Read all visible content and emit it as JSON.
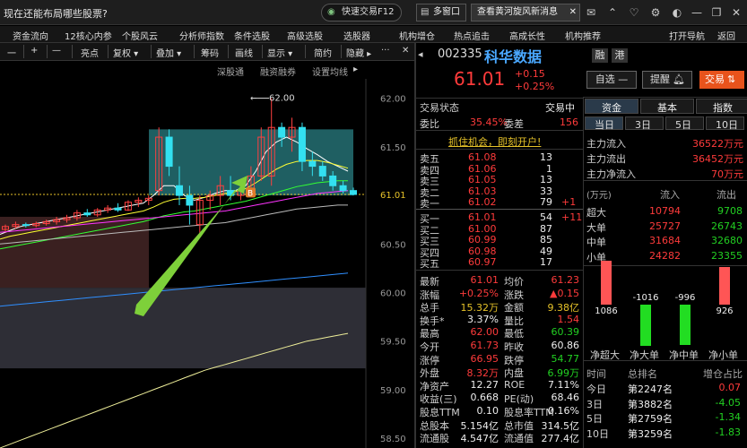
{
  "topbar": {
    "question": "现在还能布局哪些股票?",
    "quick_trade": "快速交易F12",
    "multi_window": "多窗口",
    "ad_text": "查看黄河旋风新消息",
    "ad_close": "✕"
  },
  "menu": [
    "资金流向",
    "12核心内参",
    "个股风云",
    "分析师指数",
    "条件选股",
    "高级选股",
    "选股器",
    "机构增仓",
    "热点追击",
    "高成长性",
    "机构推荐",
    "打开导航",
    "返回"
  ],
  "toolbar": [
    "一",
    "+",
    "—",
    "亮点",
    "复权 ▾",
    "叠加 ▾",
    "筹码",
    "画线",
    "显示 ▾",
    "简约",
    "隐藏 ▸"
  ],
  "subbar": [
    "深股通",
    "融资融券",
    "设置均线"
  ],
  "chart_data": {
    "type": "candlestick",
    "y_ticks": [
      "62.00",
      "61.50",
      "61.01",
      "60.50",
      "60.00",
      "59.50",
      "59.00",
      "58.50"
    ],
    "ylim": [
      58.4,
      62.2
    ],
    "last_price_label": "61.01",
    "high_annotation": "62.00",
    "b_marker": "B",
    "candles": [
      [
        60.65,
        60.7,
        60.63,
        60.68
      ],
      [
        60.68,
        60.73,
        60.66,
        60.7
      ],
      [
        60.7,
        60.72,
        60.67,
        60.69
      ],
      [
        60.69,
        60.73,
        60.67,
        60.71
      ],
      [
        60.71,
        60.75,
        60.69,
        60.73
      ],
      [
        60.73,
        60.78,
        60.7,
        60.75
      ],
      [
        60.75,
        60.8,
        60.72,
        60.77
      ],
      [
        60.77,
        60.85,
        60.74,
        60.82
      ],
      [
        60.82,
        60.86,
        60.78,
        60.8
      ],
      [
        60.8,
        60.87,
        60.78,
        60.85
      ],
      [
        60.85,
        60.9,
        60.82,
        60.87
      ],
      [
        60.87,
        60.92,
        60.83,
        60.85
      ],
      [
        60.85,
        60.95,
        60.84,
        60.93
      ],
      [
        60.93,
        60.98,
        60.88,
        60.95
      ],
      [
        60.95,
        61.0,
        60.9,
        60.97
      ],
      [
        61.05,
        61.7,
        61.0,
        61.6
      ],
      [
        61.6,
        61.68,
        61.2,
        61.3
      ],
      [
        61.1,
        61.3,
        60.9,
        61.0
      ],
      [
        61.0,
        61.1,
        60.7,
        60.9
      ],
      [
        60.7,
        61.0,
        60.6,
        60.95
      ],
      [
        60.95,
        61.05,
        60.85,
        61.0
      ],
      [
        61.0,
        61.2,
        60.9,
        61.1
      ],
      [
        61.05,
        61.2,
        60.95,
        61.0
      ],
      [
        61.0,
        61.1,
        60.95,
        61.05
      ],
      [
        61.05,
        61.3,
        61.0,
        61.2
      ],
      [
        61.2,
        61.7,
        61.15,
        61.6
      ],
      [
        61.2,
        62.0,
        61.1,
        61.7
      ],
      [
        61.7,
        61.75,
        61.5,
        61.6
      ],
      [
        61.6,
        61.8,
        61.45,
        61.7
      ],
      [
        61.7,
        61.75,
        61.25,
        61.35
      ],
      [
        61.35,
        61.45,
        61.2,
        61.3
      ],
      [
        61.3,
        61.35,
        61.15,
        61.2
      ],
      [
        61.2,
        61.25,
        61.05,
        61.1
      ],
      [
        61.1,
        61.15,
        61.02,
        61.05
      ],
      [
        61.05,
        61.08,
        61.0,
        61.01
      ]
    ],
    "ma_series": [
      {
        "color": "#ffffff",
        "values": [
          60.6,
          60.64,
          60.68,
          60.7,
          60.72,
          60.74,
          60.76,
          60.78,
          60.8,
          60.82,
          60.84,
          60.86,
          60.88,
          60.9,
          60.92,
          61.0,
          61.1,
          61.1,
          61.0,
          60.95,
          60.98,
          61.02,
          61.05,
          61.05,
          61.1,
          61.25,
          61.45,
          61.55,
          61.6,
          61.55,
          61.48,
          61.42,
          61.35,
          61.3,
          61.25
        ]
      },
      {
        "color": "#ffff33",
        "values": [
          60.55,
          60.58,
          60.6,
          60.62,
          60.64,
          60.66,
          60.68,
          60.7,
          60.72,
          60.74,
          60.76,
          60.78,
          60.8,
          60.82,
          60.84,
          60.88,
          60.93,
          60.96,
          60.97,
          60.97,
          60.98,
          61.0,
          61.02,
          61.04,
          61.07,
          61.13,
          61.2,
          61.27,
          61.32,
          61.35,
          61.36,
          61.36,
          61.34,
          61.31,
          61.28
        ]
      },
      {
        "color": "#33ff33",
        "values": [
          60.45,
          60.47,
          60.49,
          60.51,
          60.53,
          60.55,
          60.57,
          60.59,
          60.61,
          60.63,
          60.65,
          60.67,
          60.69,
          60.71,
          60.73,
          60.76,
          60.79,
          60.81,
          60.83,
          60.84,
          60.86,
          60.88,
          60.9,
          60.92,
          60.94,
          60.97,
          61.0,
          61.03,
          61.06,
          61.09,
          61.11,
          61.13,
          61.14,
          61.15,
          61.15
        ]
      },
      {
        "color": "#ff33ff",
        "values": [
          60.62,
          60.63,
          60.64,
          60.65,
          60.66,
          60.67,
          60.68,
          60.69,
          60.7,
          60.71,
          60.72,
          60.73,
          60.74,
          60.75,
          60.76,
          60.77,
          60.78,
          60.79,
          60.8,
          60.81,
          60.82,
          60.83,
          60.84,
          60.86,
          60.88,
          60.9,
          60.92,
          60.94,
          60.96,
          60.98,
          61.0,
          61.02,
          61.03,
          61.04,
          61.05
        ]
      },
      {
        "color": "#bbbbbb",
        "values": [
          60.5,
          60.51,
          60.52,
          60.53,
          60.54,
          60.55,
          60.56,
          60.57,
          60.58,
          60.59,
          60.6,
          60.61,
          60.62,
          60.63,
          60.64,
          60.65,
          60.66,
          60.67,
          60.68,
          60.69,
          60.7,
          60.71,
          60.72,
          60.74,
          60.76,
          60.78,
          60.8,
          60.82,
          60.84,
          60.86,
          60.87,
          60.88,
          60.89,
          60.9,
          60.9
        ]
      },
      {
        "color": "#2f8fff",
        "values": [
          59.86,
          59.87,
          59.88,
          59.89,
          59.9,
          59.91,
          59.92,
          59.93,
          59.94,
          59.95,
          59.96,
          59.97,
          59.98,
          59.99,
          60.0,
          60.01,
          60.02,
          60.03,
          60.04,
          60.05,
          60.06,
          60.07,
          60.08,
          60.09,
          60.1,
          60.11,
          60.12,
          60.13,
          60.14,
          60.15,
          60.16,
          60.17,
          60.18,
          60.19,
          60.2
        ]
      },
      {
        "color": "#eeee99",
        "values": [
          58.4,
          58.44,
          58.48,
          58.52,
          58.56,
          58.6,
          58.64,
          58.68,
          58.72,
          58.76,
          58.8,
          58.84,
          58.88,
          58.92,
          58.96,
          59.0,
          59.04,
          59.08,
          59.12,
          59.16,
          59.2,
          59.23,
          59.26,
          59.29,
          59.32,
          59.35,
          59.38,
          59.41,
          59.44,
          59.47,
          59.5,
          59.52,
          59.54,
          59.56,
          59.58
        ]
      }
    ]
  },
  "stock": {
    "code": "002335",
    "name": "科华数据",
    "rong": "融",
    "gang": "港",
    "price": "61.01",
    "change": "+0.15",
    "pct": "+0.25%",
    "watch": "自选 —",
    "alert": "提醒",
    "trade": "交易"
  },
  "tabs": [
    "资金",
    "基本",
    "指数"
  ],
  "ttabs": [
    "当日",
    "3日",
    "5日",
    "10日"
  ],
  "trade_status": {
    "label": "交易状态",
    "value": "交易中"
  },
  "weibi": {
    "l1": "委比",
    "v1": "35.45%",
    "l2": "委差",
    "v2": "156"
  },
  "promo": "抓住机会，即刻开户!",
  "asks": [
    [
      "卖五",
      "61.08",
      "13",
      ""
    ],
    [
      "卖四",
      "61.06",
      "1",
      ""
    ],
    [
      "卖三",
      "61.05",
      "13",
      ""
    ],
    [
      "卖二",
      "61.03",
      "33",
      ""
    ],
    [
      "卖一",
      "61.02",
      "79",
      "+1"
    ]
  ],
  "bids": [
    [
      "买一",
      "61.01",
      "54",
      "+11"
    ],
    [
      "买二",
      "61.00",
      "87",
      ""
    ],
    [
      "买三",
      "60.99",
      "85",
      ""
    ],
    [
      "买四",
      "60.98",
      "49",
      ""
    ],
    [
      "买五",
      "60.97",
      "17",
      ""
    ]
  ],
  "stats": [
    [
      "最新",
      "61.01",
      "均价",
      "61.23"
    ],
    [
      "涨幅",
      "+0.25%",
      "涨跌",
      "▲0.15"
    ],
    [
      "总手",
      "15.32万",
      "金额",
      "9.38亿"
    ],
    [
      "换手*",
      "3.37%",
      "量比",
      "1.54"
    ],
    [
      "最高",
      "62.00",
      "最低",
      "60.39"
    ],
    [
      "今开",
      "61.73",
      "昨收",
      "60.86"
    ],
    [
      "涨停",
      "66.95",
      "跌停",
      "54.77"
    ],
    [
      "外盘",
      "8.32万",
      "内盘",
      "6.99万"
    ],
    [
      "净资产",
      "12.27",
      "ROE",
      "7.11%"
    ],
    [
      "收益(三)",
      "0.668",
      "PE(动)",
      "68.46"
    ],
    [
      "股息TTM",
      "0.10",
      "股息率TTM",
      "0.16%"
    ],
    [
      "总股本",
      "5.154亿",
      "总市值",
      "314.5亿"
    ],
    [
      "流通股",
      "4.547亿",
      "流通值",
      "277.4亿"
    ]
  ],
  "flow": [
    {
      "label": "主力流入",
      "value": "36522万元"
    },
    {
      "label": "主力流出",
      "value": "36452万元"
    },
    {
      "label": "主力净流入",
      "value": "70万元"
    }
  ],
  "unit": "(万元)",
  "col_in": "流入",
  "col_out": "流出",
  "size_rows": [
    [
      "超大",
      "10794",
      "9708"
    ],
    [
      "大单",
      "25727",
      "26743"
    ],
    [
      "中单",
      "31684",
      "32680"
    ],
    [
      "小单",
      "24282",
      "23355"
    ]
  ],
  "net_bars": [
    {
      "label": "净超大",
      "value": 1086
    },
    {
      "label": "净大单",
      "value": -1016
    },
    {
      "label": "净中单",
      "value": -996
    },
    {
      "label": "净小单",
      "value": 926
    }
  ],
  "rank_head": [
    "时间",
    "总排名",
    "增仓占比"
  ],
  "ranks": [
    [
      "今日",
      "第2247名",
      "0.07"
    ],
    [
      "3日",
      "第3882名",
      "-4.05"
    ],
    [
      "5日",
      "第2759名",
      "-1.34"
    ],
    [
      "10日",
      "第3259名",
      "-1.83"
    ]
  ]
}
